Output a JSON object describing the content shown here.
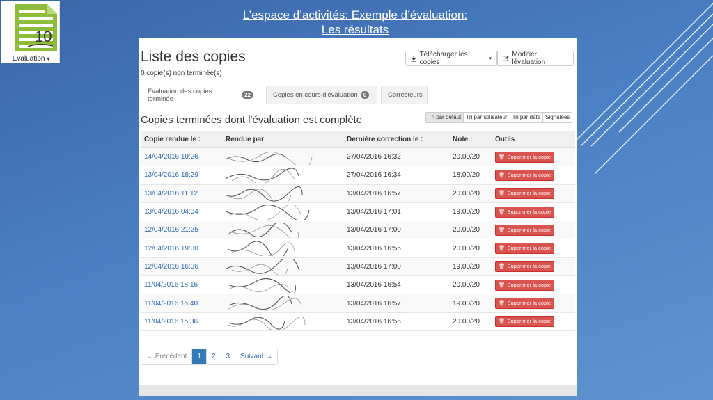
{
  "slide": {
    "title_line1": "L’espace d’activités: Exemple d’évaluation:",
    "title_line2": "Les résultats"
  },
  "logo": {
    "label": "Evaluation",
    "caret": "▾",
    "icon_number": "10",
    "accent_color": "#8dbb3a"
  },
  "page": {
    "title": "Liste des copies",
    "subtitle": "0 copie(s) non terminée(s)",
    "download_button": "Télécharger les copies",
    "edit_button": "Modifier lévaluation"
  },
  "tabs": [
    {
      "label": "Évaluation des copies terminée",
      "badge": "22"
    },
    {
      "label": "Copies en cours d'évaluation",
      "badge": "0"
    },
    {
      "label": "Correcteurs"
    }
  ],
  "section": {
    "title": "Copies terminées dont l'évaluation est complète",
    "sort_options": [
      "Tri par défaut",
      "Tri par utilisateur",
      "Tri par date",
      "Signalées"
    ]
  },
  "table": {
    "headers": [
      "Copie rendue le :",
      "Rendue par",
      "Dernière correction le :",
      "Note :",
      "Outils"
    ],
    "delete_label": "Supprimer la copie",
    "rows": [
      {
        "rendue": "14/04/2016 19:26",
        "correction": "27/04/2016 16:32",
        "note": "20.00/20"
      },
      {
        "rendue": "13/04/2016 18:29",
        "correction": "27/04/2016 16:34",
        "note": "18.00/20"
      },
      {
        "rendue": "13/04/2016 11:12",
        "correction": "13/04/2016 16:57",
        "note": "20.00/20"
      },
      {
        "rendue": "13/04/2016 04:34",
        "correction": "13/04/2016 17:01",
        "note": "19.00/20"
      },
      {
        "rendue": "12/04/2016 21:25",
        "correction": "13/04/2016 17:00",
        "note": "20.00/20"
      },
      {
        "rendue": "12/04/2016 19:30",
        "correction": "13/04/2016 16:55",
        "note": "20.00/20"
      },
      {
        "rendue": "12/04/2016 16:36",
        "correction": "13/04/2016 17:00",
        "note": "19.00/20"
      },
      {
        "rendue": "11/04/2016 18:16",
        "correction": "13/04/2016 16:54",
        "note": "20.00/20"
      },
      {
        "rendue": "11/04/2016 15:40",
        "correction": "13/04/2016 16:57",
        "note": "19.00/20"
      },
      {
        "rendue": "11/04/2016 15:36",
        "correction": "13/04/2016 16:56",
        "note": "20.00/20"
      }
    ]
  },
  "pagination": {
    "previous": "← Précédent",
    "pages": [
      "1",
      "2",
      "3"
    ],
    "next": "Suivant →",
    "active_page": "1"
  },
  "colors": {
    "link": "#2a6cb0",
    "danger": "#d9534f",
    "primary": "#337ab7"
  }
}
